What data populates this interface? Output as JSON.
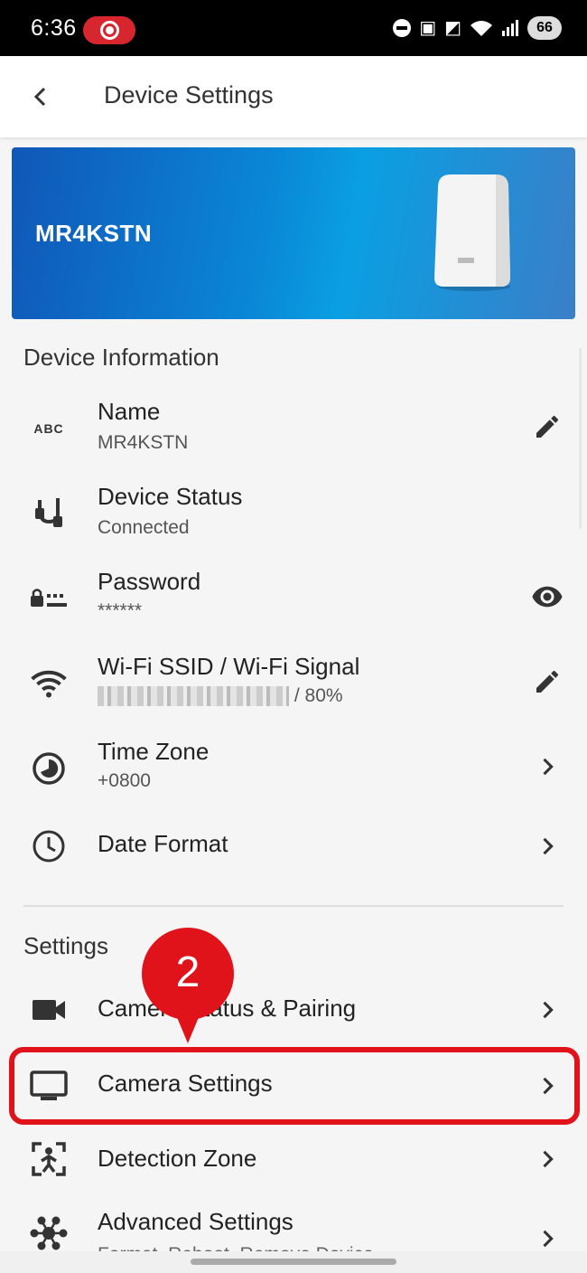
{
  "status_bar": {
    "time": "6:36",
    "battery": "66"
  },
  "header": {
    "title": "Device Settings"
  },
  "banner": {
    "device_name": "MR4KSTN"
  },
  "device_info": {
    "section_title": "Device Information",
    "items": [
      {
        "icon": "abc-icon",
        "label": "Name",
        "value": "MR4KSTN",
        "action": "edit-icon"
      },
      {
        "icon": "device-status-icon",
        "label": "Device Status",
        "value": "Connected"
      },
      {
        "icon": "password-icon",
        "label": "Password",
        "value": "******",
        "action": "visibility-icon"
      },
      {
        "icon": "wifi-icon",
        "label": "Wi-Fi SSID / Wi-Fi Signal",
        "value": "/ 80%",
        "action": "edit-icon"
      },
      {
        "icon": "time-zone-icon",
        "label": "Time Zone",
        "value": "+0800",
        "action": "chevron-right-icon"
      },
      {
        "icon": "clock-icon",
        "label": "Date Format",
        "action": "chevron-right-icon"
      }
    ]
  },
  "settings": {
    "section_title": "Settings",
    "items": [
      {
        "icon": "video-camera-icon",
        "label": "Camera Status & Pairing"
      },
      {
        "icon": "monitor-icon",
        "label": "Camera Settings"
      },
      {
        "icon": "detection-zone-icon",
        "label": "Detection Zone"
      },
      {
        "icon": "advanced-settings-icon",
        "label": "Advanced Settings",
        "value": "Format, Reboot, Remove Device"
      }
    ]
  },
  "annotation": {
    "step": "2",
    "color": "#e0131b"
  },
  "colors": {
    "accent": "#e0131b",
    "banner_start": "#1057b8",
    "banner_mid": "#0a9fe2"
  }
}
